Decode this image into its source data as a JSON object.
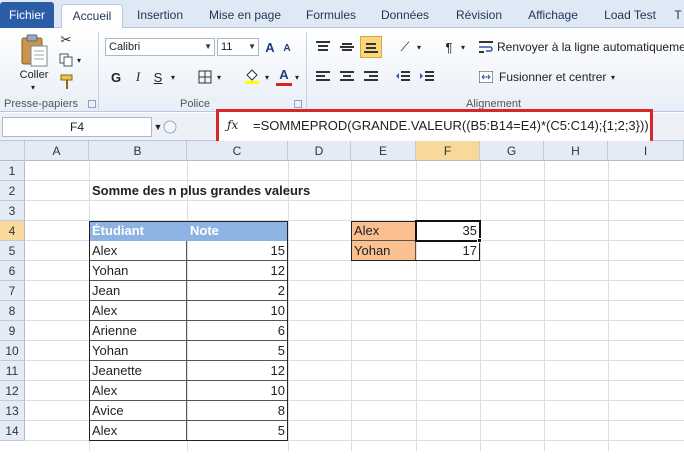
{
  "tabs": [
    "Fichier",
    "Accueil",
    "Insertion",
    "Mise en page",
    "Formules",
    "Données",
    "Révision",
    "Affichage",
    "Load Test",
    "T"
  ],
  "ribbon": {
    "paste_label": "Coller",
    "clipboard_group": "Presse-papiers",
    "font_group": "Police",
    "alignment_group": "Alignement",
    "font_name": "Calibri",
    "font_size": "11",
    "bold": "G",
    "italic": "I",
    "underline": "S",
    "grow_font": "A",
    "shrink_font": "A",
    "font_color_label": "A",
    "wrap_text": "Renvoyer à la ligne automatiquement",
    "merge_center": "Fusionner et centrer"
  },
  "formula_bar": {
    "name_box": "F4",
    "fx": "fx",
    "formula": "=SOMMEPROD(GRANDE.VALEUR((B5:B14=E4)*(C5:C14);{1;2;3}))"
  },
  "columns": [
    "A",
    "B",
    "C",
    "D",
    "E",
    "F",
    "G",
    "H",
    "I"
  ],
  "rows": [
    "1",
    "2",
    "3",
    "4",
    "5",
    "6",
    "7",
    "8",
    "9",
    "10",
    "11",
    "12",
    "13",
    "14"
  ],
  "sheet": {
    "title": "Somme des n plus grandes valeurs",
    "table_headers": [
      "Étudiant",
      "Note"
    ],
    "table_rows": [
      [
        "Alex",
        "15"
      ],
      [
        "Yohan",
        "12"
      ],
      [
        "Jean",
        "2"
      ],
      [
        "Alex",
        "10"
      ],
      [
        "Arienne",
        "6"
      ],
      [
        "Yohan",
        "5"
      ],
      [
        "Jeanette",
        "12"
      ],
      [
        "Alex",
        "10"
      ],
      [
        "Avice",
        "8"
      ],
      [
        "Alex",
        "5"
      ]
    ],
    "results": [
      [
        "Alex",
        "35"
      ],
      [
        "Yohan",
        "17"
      ]
    ]
  },
  "colors": {
    "file_tab": "#2c5ea8",
    "table_header": "#8db3e2",
    "result_label": "#fac090",
    "highlight_box": "#d8262a",
    "selected_header": "#f9d99b"
  }
}
